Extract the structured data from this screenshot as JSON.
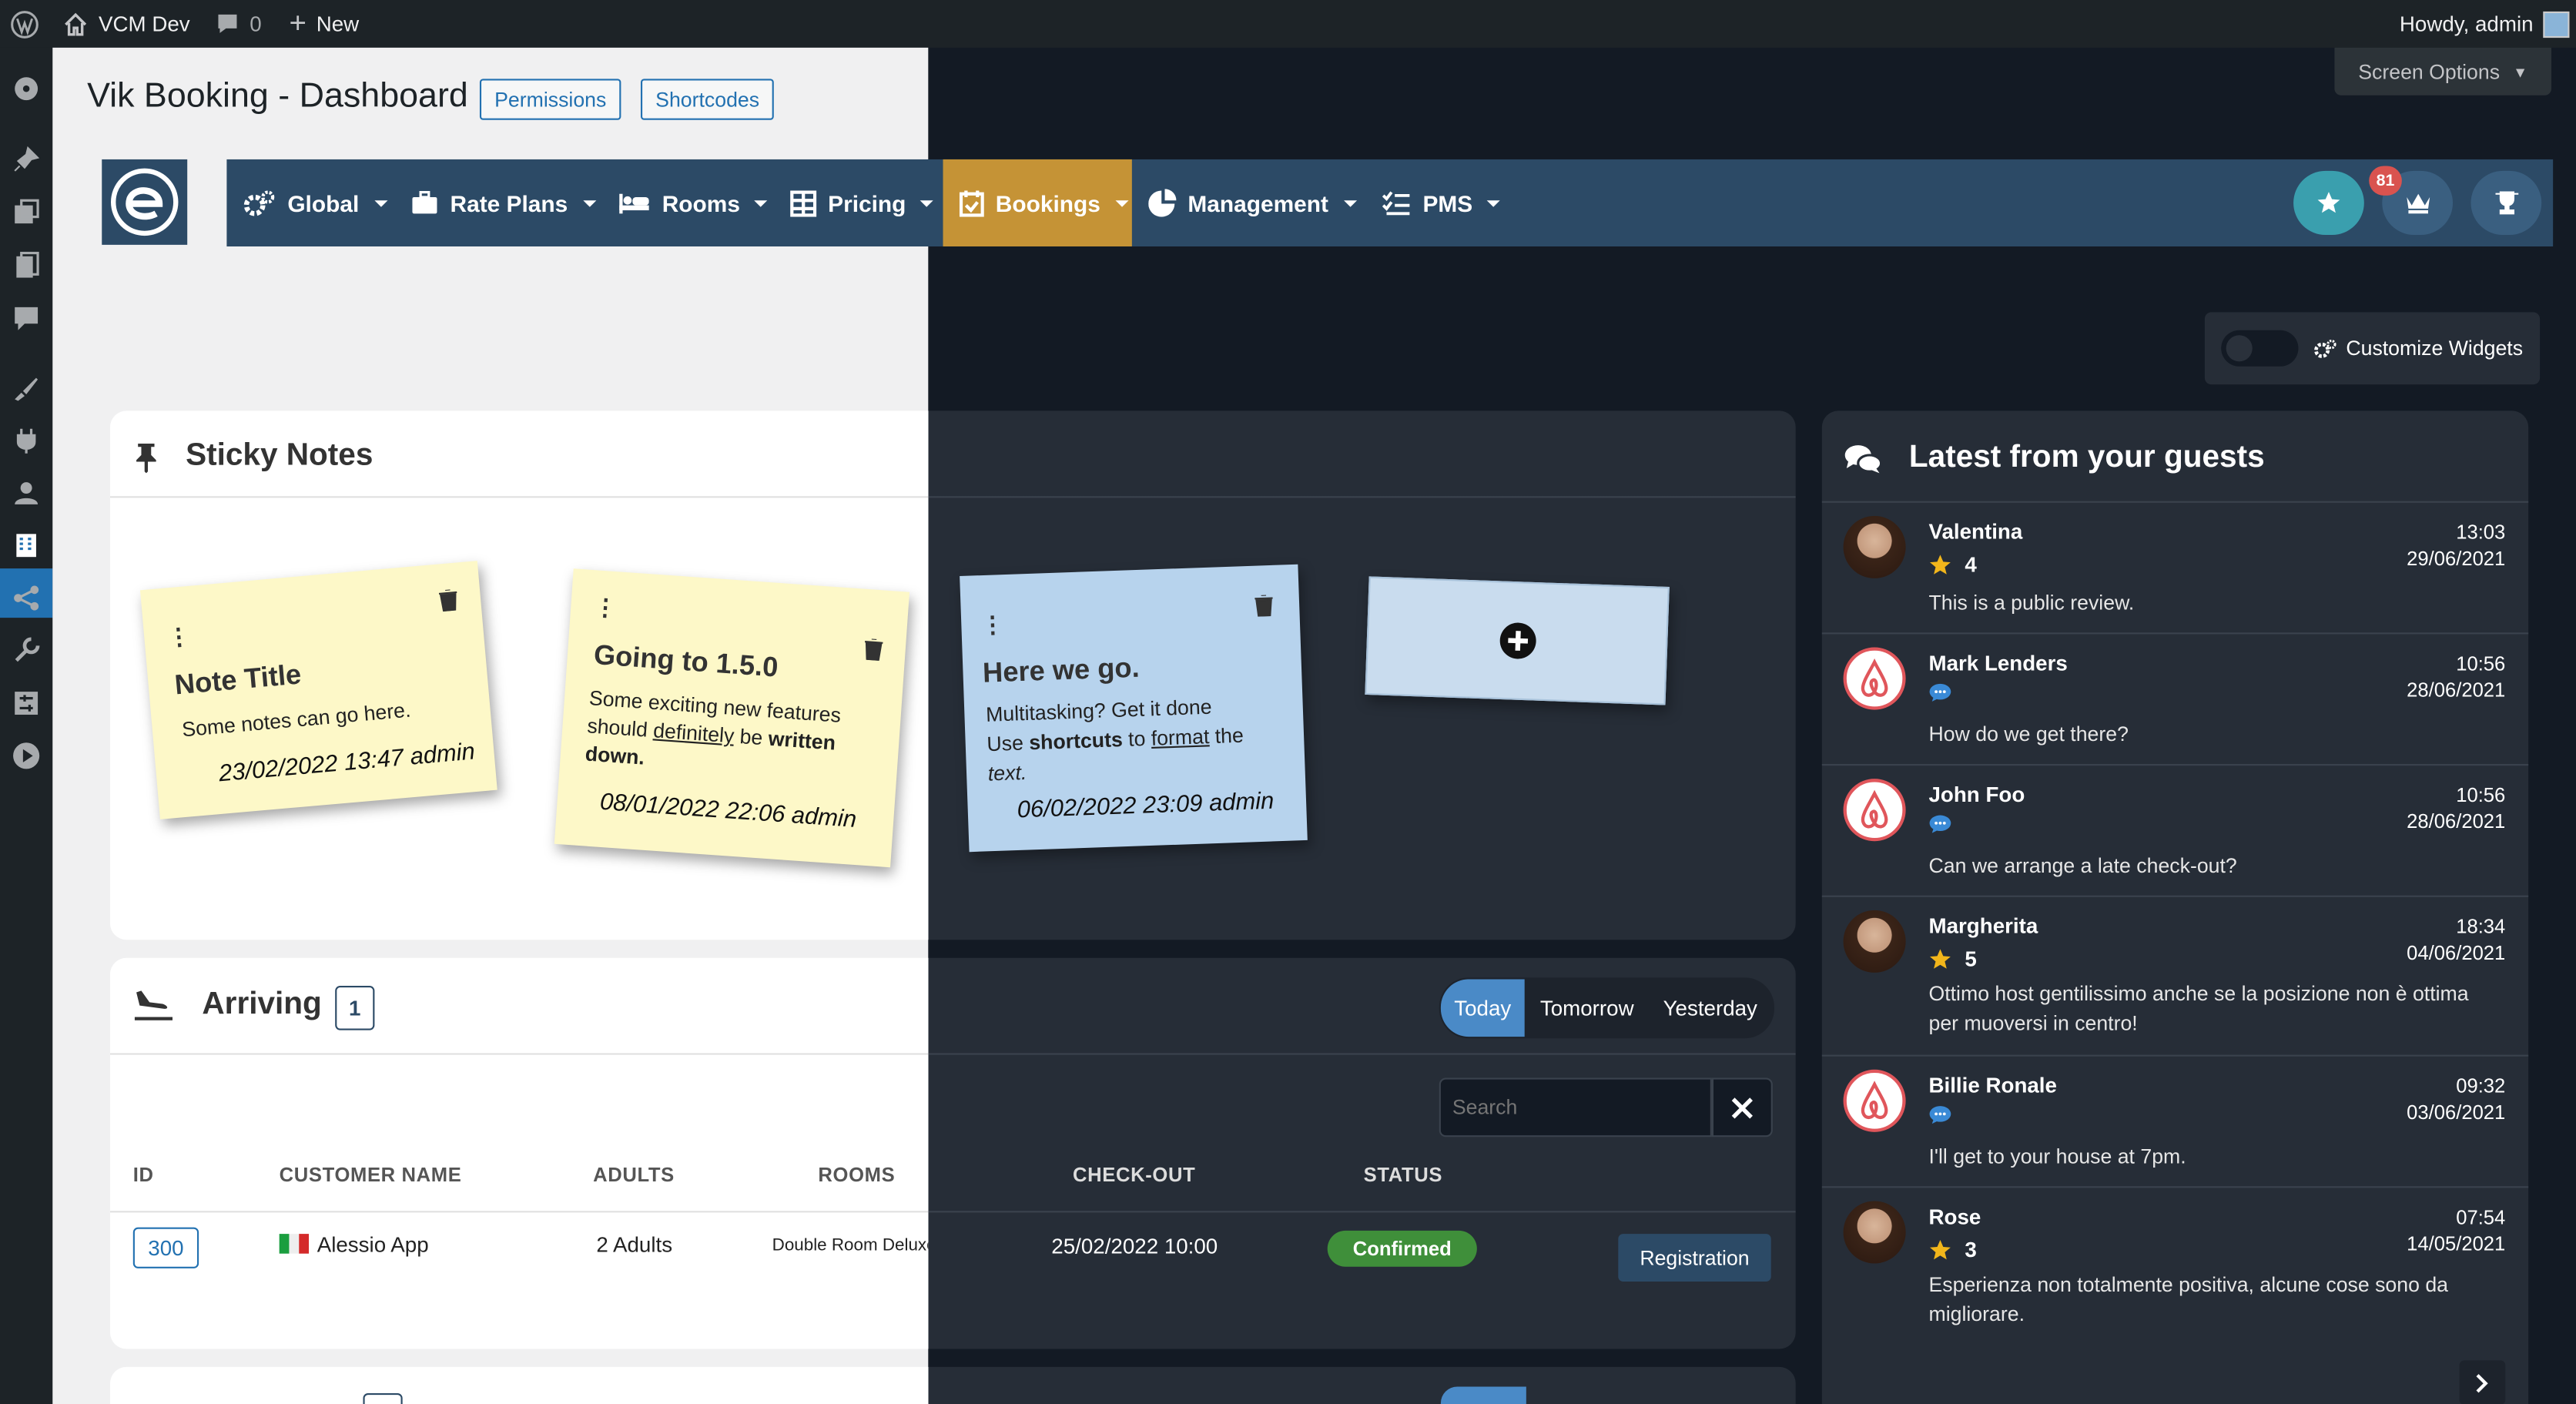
{
  "adminbar": {
    "site_name": "VCM Dev",
    "comments_count": "0",
    "new_label": "New",
    "howdy": "Howdy, admin"
  },
  "screen_options": "Screen Options",
  "page": {
    "title": "Vik Booking - Dashboard",
    "permissions_btn": "Permissions",
    "shortcodes_btn": "Shortcodes"
  },
  "nav": {
    "items": [
      {
        "label": "Global",
        "icon": "gears-icon"
      },
      {
        "label": "Rate Plans",
        "icon": "briefcase-icon"
      },
      {
        "label": "Rooms",
        "icon": "bed-icon"
      },
      {
        "label": "Pricing",
        "icon": "grid-icon"
      },
      {
        "label": "Bookings",
        "icon": "calendar-check-icon"
      },
      {
        "label": "Management",
        "icon": "pie-chart-icon"
      },
      {
        "label": "PMS",
        "icon": "list-check-icon"
      }
    ],
    "badge": "81",
    "active_color": "#c59336"
  },
  "customize_widgets": "Customize Widgets",
  "sticky_notes": {
    "title": "Sticky Notes",
    "notes": [
      {
        "title": "Note Title",
        "body": "Some notes can go here.",
        "footer": "23/02/2022 13:47 admin",
        "color": "#fdf8c8"
      },
      {
        "title": "Going to 1.5.0",
        "body_parts": [
          "Some exciting new features should ",
          "definitely",
          " be ",
          "written down."
        ],
        "footer": "08/01/2022 22:06 admin",
        "color": "#fdf8c8"
      },
      {
        "title": "Here we go.",
        "body_parts": [
          "Multitasking? Get it done",
          "Use ",
          "shortcuts",
          " to ",
          "format",
          " the",
          "text."
        ],
        "footer": "06/02/2022 23:09 admin",
        "color": "#b7d3ed"
      }
    ]
  },
  "arriving": {
    "title": "Arriving",
    "count": "1",
    "tabs": [
      "Today",
      "Tomorrow",
      "Yesterday"
    ],
    "search_placeholder": "Search",
    "columns": [
      "ID",
      "CUSTOMER NAME",
      "ADULTS",
      "ROOMS",
      "CHECK-OUT",
      "STATUS"
    ],
    "rows": [
      {
        "id": "300",
        "customer": "Alessio App",
        "adults": "2 Adults",
        "room": "Double Room Deluxe",
        "checkout": "25/02/2022 10:00",
        "status": "Confirmed",
        "action": "Registration"
      }
    ]
  },
  "guests": {
    "title": "Latest from your guests",
    "reviews": [
      {
        "name": "Valentina",
        "time": "13:03",
        "date": "29/06/2021",
        "score": "4",
        "text": "This is a public review.",
        "avatar": "person"
      },
      {
        "name": "Mark Lenders",
        "time": "10:56",
        "date": "28/06/2021",
        "score": "",
        "text": "How do we get there?",
        "avatar": "airbnb"
      },
      {
        "name": "John Foo",
        "time": "10:56",
        "date": "28/06/2021",
        "score": "",
        "text": "Can we arrange a late check-out?",
        "avatar": "airbnb"
      },
      {
        "name": "Margherita",
        "time": "18:34",
        "date": "04/06/2021",
        "score": "5",
        "text": "Ottimo host gentilissimo anche se la posizione non è ottima per muoversi in centro!",
        "avatar": "person"
      },
      {
        "name": "Billie Ronale",
        "time": "09:32",
        "date": "03/06/2021",
        "score": "",
        "text": "I'll get to your house at 7pm.",
        "avatar": "airbnb"
      },
      {
        "name": "Rose",
        "time": "07:54",
        "date": "14/05/2021",
        "score": "3",
        "text": "Esperienza non totalmente positiva, alcune cose sono da migliorare.",
        "avatar": "person"
      }
    ]
  }
}
